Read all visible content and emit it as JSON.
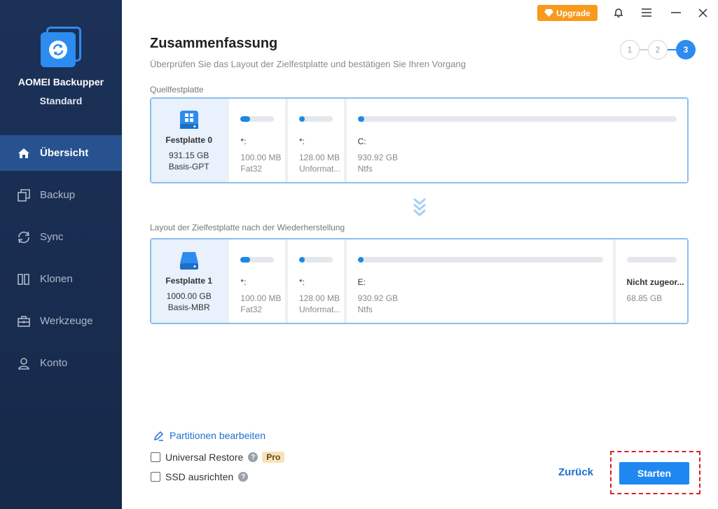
{
  "app": {
    "name": "AOMEI Backupper",
    "edition": "Standard"
  },
  "sidebar": {
    "items": [
      {
        "label": "Übersicht",
        "icon": "home-icon",
        "active": true
      },
      {
        "label": "Backup",
        "icon": "backup-icon",
        "active": false
      },
      {
        "label": "Sync",
        "icon": "sync-icon",
        "active": false
      },
      {
        "label": "Klonen",
        "icon": "clone-icon",
        "active": false
      },
      {
        "label": "Werkzeuge",
        "icon": "toolbox-icon",
        "active": false
      },
      {
        "label": "Konto",
        "icon": "user-icon",
        "active": false
      }
    ]
  },
  "titlebar": {
    "upgrade_label": "Upgrade"
  },
  "header": {
    "title": "Zusammenfassung",
    "subtitle": "Überprüfen Sie das Layout der Zielfestplatte und bestätigen Sie Ihren Vorgang",
    "steps": [
      "1",
      "2",
      "3"
    ],
    "current_step": 3
  },
  "source": {
    "label": "Quellfestplatte",
    "disk": {
      "name": "Festplatte 0",
      "size": "931.15 GB",
      "type": "Basis-GPT"
    },
    "partitions": [
      {
        "letter": "*:",
        "size": "100.00 MB",
        "fs": "Fat32",
        "used": 0.3
      },
      {
        "letter": "*:",
        "size": "128.00 MB",
        "fs": "Unformat...",
        "used": 0.06
      },
      {
        "letter": "C:",
        "size": "930.92 GB",
        "fs": "Ntfs",
        "used": 0.02
      }
    ]
  },
  "target": {
    "label": "Layout der Zielfestplatte nach der Wiederherstellung",
    "disk": {
      "name": "Festplatte 1",
      "size": "1000.00 GB",
      "type": "Basis-MBR"
    },
    "partitions": [
      {
        "letter": "*:",
        "size": "100.00 MB",
        "fs": "Fat32",
        "used": 0.3
      },
      {
        "letter": "*:",
        "size": "128.00 MB",
        "fs": "Unformat...",
        "used": 0.06
      },
      {
        "letter": "E:",
        "size": "930.92 GB",
        "fs": "Ntfs",
        "used": 0.02
      },
      {
        "letter": "Nicht zugeor...",
        "size": "68.85 GB",
        "fs": "",
        "used": 0
      }
    ]
  },
  "options": {
    "edit_partitions": "Partitionen bearbeiten",
    "universal_restore": "Universal Restore",
    "pro_badge": "Pro",
    "ssd_align": "SSD ausrichten"
  },
  "footer": {
    "back_label": "Zurück",
    "start_label": "Starten"
  },
  "colors": {
    "accent": "#1e88f0",
    "sidebar": "#1c3158",
    "upgrade": "#f89a1c",
    "highlight": "#d7232a"
  }
}
